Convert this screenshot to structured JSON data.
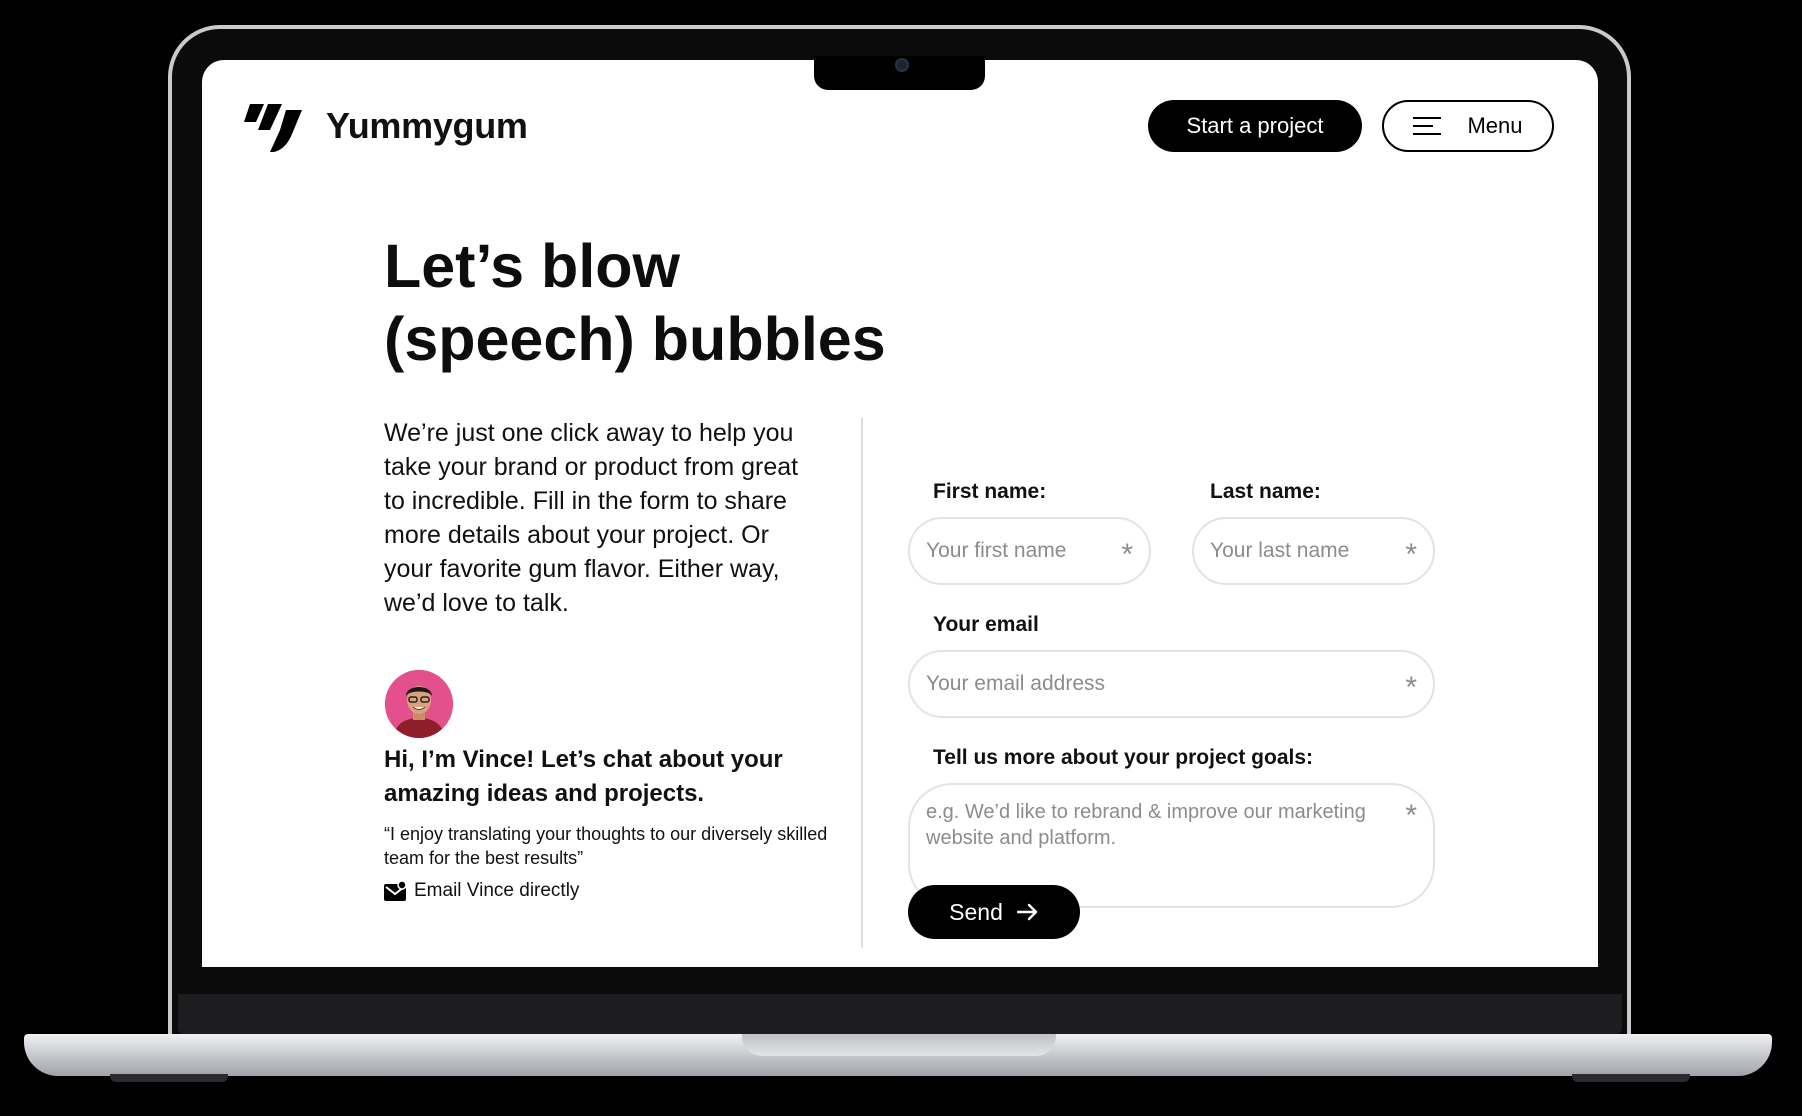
{
  "header": {
    "brand": "Yummygum",
    "start_button": "Start a project",
    "menu_button": "Menu"
  },
  "hero": {
    "headline_line1": "Let’s blow",
    "headline_line2": "(speech) bubbles",
    "intro": "We’re just one click away to help you take your brand or product from great to incredible. Fill in the form to share more details about your project. Or your favorite gum flavor. Either way, we’d love to talk."
  },
  "contact_person": {
    "title": "Hi, I’m Vince! Let’s chat about your amazing ideas and projects.",
    "quote": "“I enjoy translating your thoughts to our diversely skilled team for the best results”",
    "email_link": "Email Vince directly",
    "avatar_bg": "#e4508c"
  },
  "form": {
    "first_name_label": "First name:",
    "first_name_placeholder": "Your first name",
    "last_name_label": "Last name:",
    "last_name_placeholder": "Your last name",
    "email_label": "Your email",
    "email_placeholder": "Your email address",
    "goals_label": "Tell us more about your project goals:",
    "goals_placeholder": "e.g. We’d like to rebrand & improve our marketing website and platform.",
    "required_marker": "*",
    "send_button": "Send"
  },
  "icons": {
    "logo": "yummygum-logo-icon",
    "menu": "hamburger-icon",
    "mail": "mail-icon",
    "send": "arrow-right-icon"
  }
}
